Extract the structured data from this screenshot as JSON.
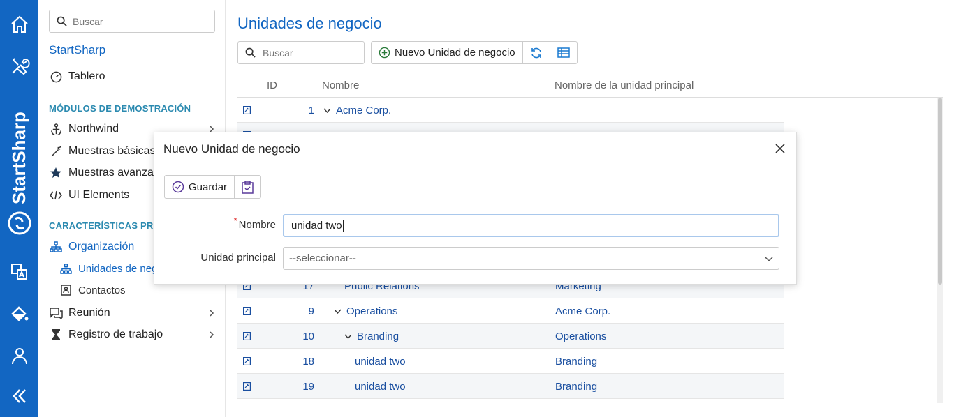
{
  "rail": {
    "brand": "StartSharp",
    "icons": [
      "home-icon",
      "tools-icon",
      "translate-icon",
      "paint-bucket-icon",
      "user-icon",
      "collapse-icon"
    ]
  },
  "sidebar": {
    "search_placeholder": "Buscar",
    "app_title": "StartSharp",
    "dashboard": "Tablero",
    "section_demo": "MÓDULOS DE DEMOSTRACIÓN",
    "northwind": "Northwind",
    "basic_samples": "Muestras básicas",
    "advanced_samples": "Muestras avanzadas",
    "ui_elements": "UI Elements",
    "section_features": "CARACTERÍSTICAS PRO",
    "organization": "Organización",
    "business_units": "Unidades de negocio",
    "contacts": "Contactos",
    "meeting": "Reunión",
    "work_log": "Registro de trabajo"
  },
  "main": {
    "title": "Unidades de negocio",
    "search_placeholder": "Buscar",
    "new_button": "Nuevo Unidad de negocio",
    "columns": {
      "id": "ID",
      "name": "Nombre",
      "parent": "Nombre de la unidad principal"
    },
    "rows": [
      {
        "id": "1",
        "name": "Acme Corp.",
        "parent": "",
        "toggle": "expanded",
        "indent": 0
      },
      {
        "id": "",
        "name": "",
        "parent": "",
        "toggle": "",
        "indent": 1
      },
      {
        "id": "",
        "name": "",
        "parent": "",
        "toggle": "",
        "indent": 1
      },
      {
        "id": "",
        "name": "",
        "parent": "",
        "toggle": "",
        "indent": 1
      },
      {
        "id": "",
        "name": "",
        "parent": "",
        "toggle": "",
        "indent": 1
      },
      {
        "id": "",
        "name": "",
        "parent": "",
        "toggle": "",
        "indent": 1
      },
      {
        "id": "",
        "name": "",
        "parent": "",
        "toggle": "",
        "indent": 1
      },
      {
        "id": "17",
        "name": "Public Relations",
        "parent": "Marketing",
        "toggle": "",
        "indent": 2
      },
      {
        "id": "9",
        "name": "Operations",
        "parent": "Acme Corp.",
        "toggle": "expanded",
        "indent": 1
      },
      {
        "id": "10",
        "name": "Branding",
        "parent": "Operations",
        "toggle": "expanded",
        "indent": 2
      },
      {
        "id": "18",
        "name": "unidad two",
        "parent": "Branding",
        "toggle": "",
        "indent": 3
      },
      {
        "id": "19",
        "name": "unidad two",
        "parent": "Branding",
        "toggle": "",
        "indent": 3
      }
    ]
  },
  "dialog": {
    "title": "Nuevo Unidad de negocio",
    "save_button": "Guardar",
    "name_label": "Nombre",
    "name_required_mark": "*",
    "name_value": "unidad two",
    "parent_label": "Unidad principal",
    "parent_placeholder": "--seleccionar--"
  },
  "colors": {
    "rail": "#1266c2",
    "accent": "#1266c2",
    "section": "#2b8ab0",
    "link": "#1a4fa0"
  }
}
